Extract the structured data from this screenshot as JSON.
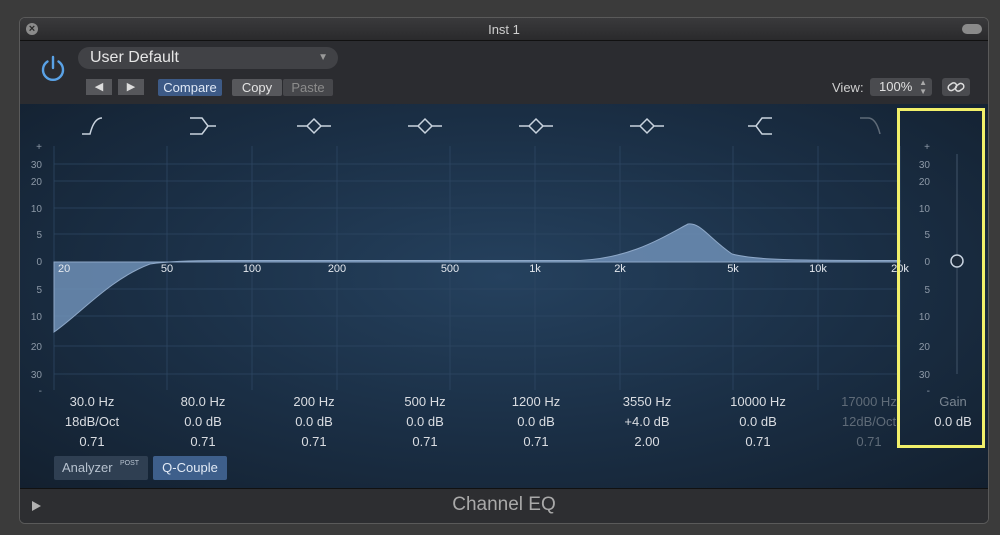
{
  "window": {
    "title": "Inst 1"
  },
  "header": {
    "preset": "User Default",
    "compare_label": "Compare",
    "copy_label": "Copy",
    "paste_label": "Paste",
    "view_label": "View:",
    "view_value": "100%"
  },
  "graph": {
    "db_scale_top": [
      "+",
      "30",
      "20",
      "10",
      "5",
      "0",
      "5",
      "10",
      "20",
      "30",
      "-"
    ],
    "freq_labels": [
      "20",
      "50",
      "100",
      "200",
      "500",
      "1k",
      "2k",
      "5k",
      "10k",
      "20k"
    ],
    "gain_scale": [
      "+",
      "30",
      "20",
      "10",
      "5",
      "0",
      "5",
      "10",
      "20",
      "30",
      "-"
    ]
  },
  "bands": [
    {
      "freq": "30.0 Hz",
      "gain": "18dB/Oct",
      "q": "0.71",
      "icon": "low-cut-icon",
      "enabled": true
    },
    {
      "freq": "80.0 Hz",
      "gain": "0.0 dB",
      "q": "0.71",
      "icon": "low-shelf-icon",
      "enabled": true
    },
    {
      "freq": "200 Hz",
      "gain": "0.0 dB",
      "q": "0.71",
      "icon": "bell-icon",
      "enabled": true
    },
    {
      "freq": "500 Hz",
      "gain": "0.0 dB",
      "q": "0.71",
      "icon": "bell-icon",
      "enabled": true
    },
    {
      "freq": "1200 Hz",
      "gain": "0.0 dB",
      "q": "0.71",
      "icon": "bell-icon",
      "enabled": true
    },
    {
      "freq": "3550 Hz",
      "gain": "+4.0 dB",
      "q": "2.00",
      "icon": "bell-icon",
      "enabled": true
    },
    {
      "freq": "10000 Hz",
      "gain": "0.0 dB",
      "q": "0.71",
      "icon": "high-shelf-icon",
      "enabled": true
    },
    {
      "freq": "17000 Hz",
      "gain": "12dB/Oct",
      "q": "0.71",
      "icon": "high-cut-icon",
      "enabled": false
    }
  ],
  "gain": {
    "label": "Gain",
    "value": "0.0 dB"
  },
  "buttons": {
    "analyzer": "Analyzer",
    "analyzer_post": "POST",
    "qcouple": "Q-Couple"
  },
  "footer": {
    "title": "Channel EQ"
  },
  "colors": {
    "accent": "#3e5f8b",
    "curve_fill": "#6f8fb6",
    "highlight": "#f1f06a"
  }
}
